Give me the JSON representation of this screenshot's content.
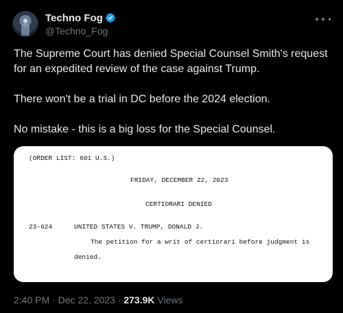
{
  "author": {
    "name": "Techno Fog",
    "handle": "@Techno_Fog",
    "verified_icon": "verified-badge-icon"
  },
  "tweet": {
    "paragraphs": [
      "The Supreme Court has denied Special Counsel Smith's request for an expedited review of the case against Trump.",
      "There won't be a trial in DC before the 2024 election.",
      "No mistake - this is a big loss for the Special Counsel."
    ]
  },
  "document": {
    "order_list": "(ORDER LIST:  601 U.S.)",
    "date": "FRIDAY, DECEMBER 22, 2023",
    "section": "CERTIORARI DENIED",
    "case_number": "23-624",
    "case_name": "UNITED STATES V. TRUMP, DONALD J.",
    "petition_line1": "The petition for a writ of certiorari before judgment is",
    "petition_line2": "denied."
  },
  "meta": {
    "time": "2:40 PM",
    "sep1": " · ",
    "date": "Dec 22, 2023",
    "sep2": " · ",
    "views_count": "273.9K",
    "views_label": " Views"
  },
  "colors": {
    "background": "#000000",
    "text": "#e7e9ea",
    "secondary": "#71767b",
    "verified": "#1d9bf0"
  },
  "icons": {
    "more": "more-horizontal-icon"
  }
}
